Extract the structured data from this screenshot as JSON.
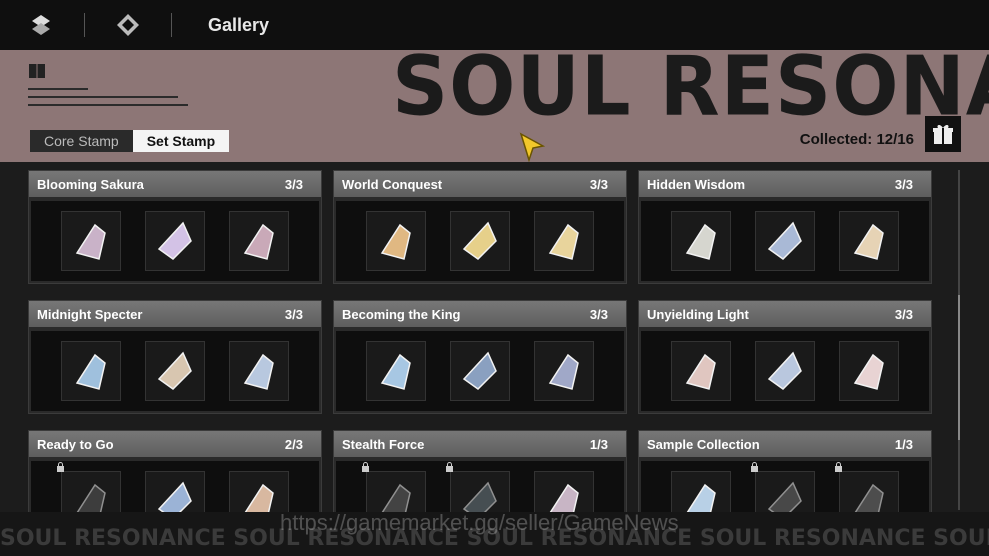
{
  "header": {
    "title": "Gallery"
  },
  "banner": {
    "big_title": "SOUL RESONANCE"
  },
  "tabs": [
    {
      "label": "Core Stamp"
    },
    {
      "label": "Set Stamp"
    }
  ],
  "collected": {
    "text": "Collected: 12/16"
  },
  "sets": [
    {
      "name": "Blooming Sakura",
      "count": "3/3",
      "colors": [
        "#c9b2c8",
        "#d3c2e6",
        "#c9a9b8"
      ],
      "locked": [
        false,
        false,
        false
      ]
    },
    {
      "name": "World Conquest",
      "count": "3/3",
      "colors": [
        "#e0b882",
        "#e6d08a",
        "#e8d49c"
      ],
      "locked": [
        false,
        false,
        false
      ]
    },
    {
      "name": "Hidden Wisdom",
      "count": "3/3",
      "colors": [
        "#d6d6cf",
        "#a9b9d6",
        "#e6d3b5"
      ],
      "locked": [
        false,
        false,
        false
      ]
    },
    {
      "name": "Midnight Specter",
      "count": "3/3",
      "colors": [
        "#9fc0dd",
        "#d8c6b0",
        "#b8c8df"
      ],
      "locked": [
        false,
        false,
        false
      ]
    },
    {
      "name": "Becoming the King",
      "count": "3/3",
      "colors": [
        "#a7c7e3",
        "#8aa0c0",
        "#a0a8c8"
      ],
      "locked": [
        false,
        false,
        false
      ]
    },
    {
      "name": "Unyielding Light",
      "count": "3/3",
      "colors": [
        "#e0c6c0",
        "#b9c7de",
        "#e8d3d3"
      ],
      "locked": [
        false,
        false,
        false
      ]
    },
    {
      "name": "Ready to Go",
      "count": "2/3",
      "colors": [
        "#5a5a5a",
        "#9bb3d6",
        "#d8b8a0"
      ],
      "locked": [
        true,
        false,
        false
      ]
    },
    {
      "name": "Stealth Force",
      "count": "1/3",
      "colors": [
        "#666",
        "#6a7a80",
        "#c8b5c5"
      ],
      "locked": [
        true,
        true,
        false
      ]
    },
    {
      "name": "Sample Collection",
      "count": "1/3",
      "colors": [
        "#b8d0e6",
        "#6e6e6e",
        "#777"
      ],
      "locked": [
        false,
        true,
        true
      ]
    }
  ],
  "footer": {
    "repeat_text": "SOUL RESONANCE   SOUL RESONANCE   SOUL RESONANCE   SOUL RESONANCE   SOUL RESONANCE   SOUL RESONANCE   SOUL RESONANCE"
  },
  "watermark": {
    "text": "https://gamemarket.gg/seller/GameNews"
  }
}
